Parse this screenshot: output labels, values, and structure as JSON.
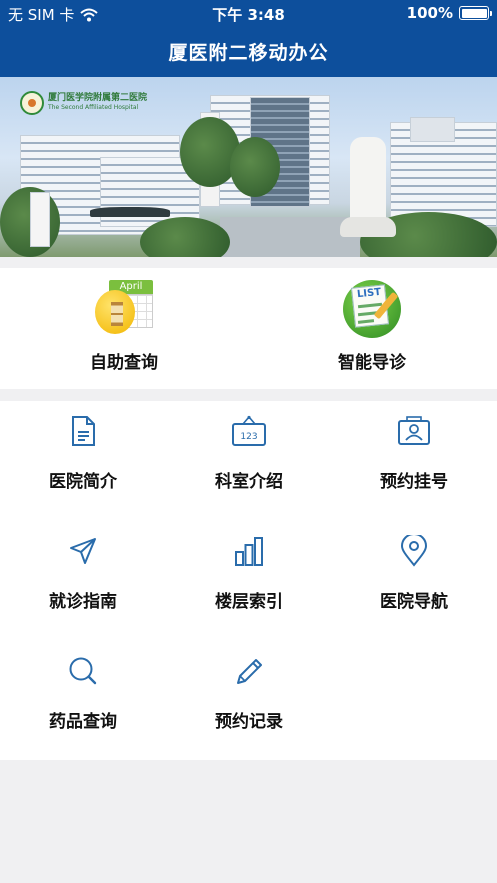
{
  "status_bar": {
    "carrier": "无 SIM 卡",
    "time": "下午 3:48",
    "battery": "100%",
    "wifi_icon": "wifi-icon",
    "battery_level": 1.0
  },
  "nav": {
    "title": "厦医附二移动办公"
  },
  "banner": {
    "logo_line1": "厦门医学院附属第二医院",
    "logo_line2": "The Second Affiliated Hospital"
  },
  "primary_actions": [
    {
      "label": "自助查询",
      "icon": "calendar-hourglass-icon"
    },
    {
      "label": "智能导诊",
      "icon": "checklist-icon"
    }
  ],
  "calendar_month": "April",
  "checklist_text": "LIST",
  "menu": [
    {
      "label": "医院简介",
      "icon": "document-icon"
    },
    {
      "label": "科室介绍",
      "icon": "sign-board-icon"
    },
    {
      "label": "预约挂号",
      "icon": "id-card-icon"
    },
    {
      "label": "就诊指南",
      "icon": "navigation-arrow-icon"
    },
    {
      "label": "楼层索引",
      "icon": "bar-chart-icon"
    },
    {
      "label": "医院导航",
      "icon": "location-pin-icon"
    },
    {
      "label": "药品查询",
      "icon": "search-icon"
    },
    {
      "label": "预约记录",
      "icon": "pencil-icon"
    }
  ],
  "sign_board_text": "123",
  "colors": {
    "header": "#0d4f9c",
    "icon_stroke": "#2a6cab",
    "background": "#f0f0f2"
  }
}
